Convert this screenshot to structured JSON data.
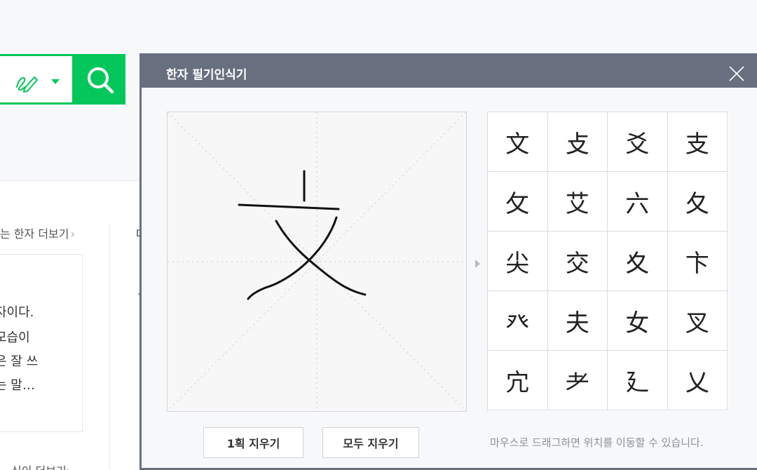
{
  "page": {
    "more_hanja_link": "는 한자 더보기",
    "info_lines": [
      "자이다.",
      "모습이",
      "은 잘 쓰",
      "는 말…"
    ],
    "bottom_link": "식이 더보기",
    "fragment_1": "대",
    "fragment_2": "ㅅ"
  },
  "modal": {
    "title": "한자 필기인식기",
    "undo_stroke_label": "1획 지우기",
    "clear_all_label": "모두 지우기",
    "hint": "마우스로 드래그하면 위치를 이동할 수 있습니다.",
    "candidates": [
      "文",
      "攴",
      "爻",
      "支",
      "攵",
      "艾",
      "六",
      "夂",
      "尖",
      "交",
      "夊",
      "卞",
      "癶",
      "夫",
      "女",
      "叉",
      "宂",
      "耂",
      "廴",
      "乂"
    ]
  },
  "colors": {
    "brand_green": "#03c75a",
    "modal_header": "#687080"
  },
  "icons": [
    "handwriting-pen-icon",
    "dropdown-caret-icon",
    "search-icon",
    "close-icon",
    "chevron-right-icon"
  ]
}
